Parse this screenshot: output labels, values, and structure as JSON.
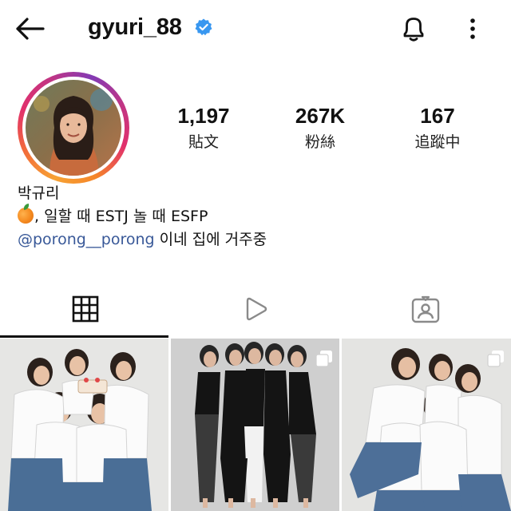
{
  "header": {
    "username": "gyuri_88",
    "verified": true,
    "icons": [
      "back-arrow-icon",
      "verified-badge-icon",
      "bell-icon",
      "more-vertical-icon"
    ]
  },
  "profile": {
    "stats": [
      {
        "value": "1,197",
        "label": "貼文"
      },
      {
        "value": "267K",
        "label": "粉絲"
      },
      {
        "value": "167",
        "label": "追蹤中"
      }
    ],
    "bio": {
      "name": "박규리",
      "line2": ", 일할 때 ESTJ  놀 때 ESFP",
      "mention": "@porong__porong",
      "line3_rest": " 이네 집에 거주중",
      "emoji": "orange-emoji-icon"
    }
  },
  "tabs": [
    {
      "name": "grid",
      "icon": "grid-icon",
      "active": true
    },
    {
      "name": "reels",
      "icon": "reels-play-icon",
      "active": false
    },
    {
      "name": "tagged",
      "icon": "tagged-person-icon",
      "active": false
    }
  ],
  "posts": [
    {
      "description": "group photo white shirts cake",
      "multi": false
    },
    {
      "description": "group photo black outfits",
      "multi": true
    },
    {
      "description": "group photo white shirts sitting",
      "multi": true
    }
  ],
  "colors": {
    "ring": [
      "#f7a234",
      "#e1306c",
      "#833ab4"
    ],
    "verified": "#3897f0",
    "mention": "#385898",
    "text": "#111111"
  }
}
